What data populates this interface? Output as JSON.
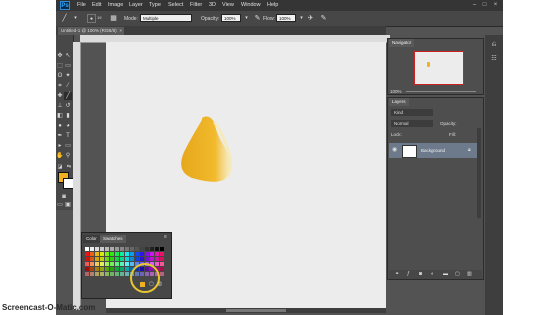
{
  "menubar": {
    "logo": "Ps",
    "items": [
      "File",
      "Edit",
      "Image",
      "Layer",
      "Type",
      "Select",
      "Filter",
      "3D",
      "View",
      "Window",
      "Help"
    ]
  },
  "options": {
    "mode_label": "Mode:",
    "mode_value": "Multiple",
    "opacity_label": "Opacity:",
    "opacity_value": "100%",
    "flow_label": "Flow:",
    "flow_value": "100%",
    "brush_size": "19"
  },
  "document": {
    "tab_title": "Untitled-1 @ 100% (RGB/8)"
  },
  "navigator": {
    "tab_label": "Navigator",
    "zoom": "100%"
  },
  "layers": {
    "tab_label": "Layers",
    "filter_kind": "Kind",
    "blend_mode": "Normal",
    "opacity_label": "Opacity:",
    "lock_label": "Lock:",
    "fill_label": "Fill:",
    "layer_name": "Background"
  },
  "swatches": {
    "tab_color": "Color",
    "tab_swatches": "Swatches"
  },
  "colors": {
    "foreground": "#f0b020",
    "background": "#ffffff",
    "stroke": "#f2b51c"
  },
  "watermark": "Screencast-O-Matic.com"
}
